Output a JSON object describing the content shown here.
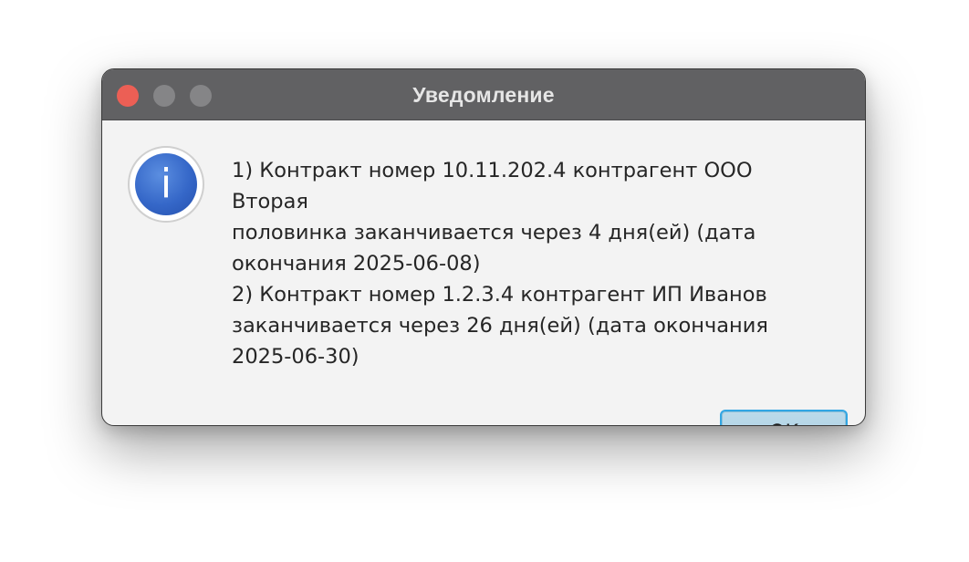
{
  "window": {
    "title": "Уведомление"
  },
  "dialog": {
    "icon": "info-icon",
    "message_lines": [
      "1) Контракт номер 10.11.202.4 контрагент ООО Вторая",
      "половинка заканчивается через 4 дня(ей) (дата",
      "окончания 2025-06-08)",
      "2) Контракт номер 1.2.3.4 контрагент ИП Иванов",
      "заканчивается через 26 дня(ей) (дата окончания",
      "2025-06-30)"
    ],
    "ok_label": "OK"
  },
  "colors": {
    "titlebar": "#616163",
    "close_button": "#ec5f55",
    "inactive_button": "#858587",
    "dialog_background": "#f3f3f3",
    "ok_border": "#32a6e3",
    "ok_fill": "#b3d5e6",
    "icon_blue": "#3567c8"
  }
}
